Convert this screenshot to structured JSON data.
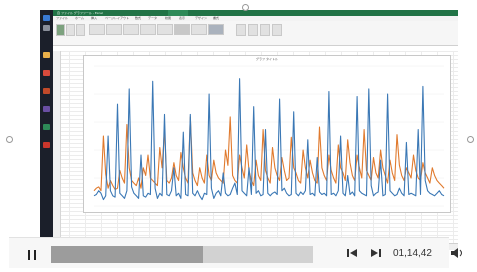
{
  "excel": {
    "title_text": "自 ファイル グラフツール - Excel",
    "tabs": [
      "ファイル",
      "ホーム",
      "挿入",
      "ページレイアウト",
      "数式",
      "データ",
      "校閲",
      "表示",
      "デザイン",
      "書式"
    ],
    "chart_title": "グラフ タイトル"
  },
  "chart_data": {
    "type": "line",
    "title": "グラフ タイトル",
    "series": [
      {
        "name": "",
        "color": "#3b78b5",
        "values": [
          8,
          9,
          12,
          10,
          5,
          8,
          55,
          12,
          8,
          7,
          80,
          10,
          8,
          6,
          12,
          92,
          15,
          10,
          8,
          6,
          40,
          8,
          7,
          10,
          9,
          98,
          14,
          6,
          10,
          8,
          72,
          9,
          8,
          12,
          30,
          8,
          10,
          6,
          58,
          9,
          8,
          72,
          10,
          8,
          12,
          8,
          5,
          10,
          9,
          88,
          14,
          6,
          10,
          12,
          8,
          26,
          10,
          8,
          9,
          14,
          18,
          9,
          100,
          12,
          10,
          8,
          30,
          9,
          78,
          10,
          12,
          8,
          9,
          60,
          10,
          8,
          10,
          11,
          9,
          84,
          12,
          14,
          10,
          8,
          9,
          74,
          10,
          8,
          11,
          9,
          12,
          52,
          9,
          10,
          8,
          38,
          11,
          9,
          10,
          8,
          90,
          9,
          10,
          8,
          12,
          55,
          10,
          8,
          24,
          9,
          11,
          8,
          86,
          12,
          10,
          9,
          8,
          92,
          16,
          8,
          10,
          11,
          36,
          8,
          9,
          88,
          12,
          10,
          8,
          9,
          14,
          10,
          8,
          50,
          9,
          10,
          9,
          8,
          60,
          9,
          94,
          20,
          12,
          10,
          9,
          8,
          10,
          12,
          9,
          8
        ]
      },
      {
        "name": "",
        "color": "#e07a2e",
        "values": [
          12,
          14,
          15,
          12,
          55,
          25,
          14,
          20,
          16,
          13,
          14,
          28,
          22,
          18,
          64,
          30,
          20,
          18,
          16,
          22,
          14,
          30,
          24,
          40,
          22,
          20,
          18,
          16,
          46,
          30,
          60,
          20,
          18,
          22,
          34,
          24,
          20,
          42,
          30,
          22,
          18,
          70,
          26,
          20,
          16,
          30,
          22,
          18,
          40,
          24,
          20,
          36,
          26,
          22,
          20,
          18,
          44,
          32,
          70,
          24,
          20,
          18,
          40,
          30,
          22,
          48,
          28,
          20,
          16,
          36,
          24,
          20,
          60,
          28,
          22,
          18,
          46,
          30,
          24,
          20,
          38,
          28,
          20,
          22,
          54,
          30,
          26,
          20,
          18,
          44,
          30,
          22,
          36,
          26,
          20,
          18,
          62,
          30,
          24,
          20,
          40,
          28,
          22,
          18,
          48,
          30,
          26,
          20,
          52,
          34,
          24,
          20,
          40,
          30,
          22,
          60,
          28,
          24,
          20,
          38,
          26,
          22,
          44,
          30,
          24,
          18,
          36,
          26,
          20,
          56,
          32,
          24,
          20,
          30,
          26,
          22,
          40,
          28,
          22,
          20,
          34,
          26,
          22,
          18,
          30,
          24,
          20,
          18,
          16,
          14
        ]
      }
    ]
  },
  "player": {
    "time": "01,14,42",
    "progress": 0.58
  }
}
